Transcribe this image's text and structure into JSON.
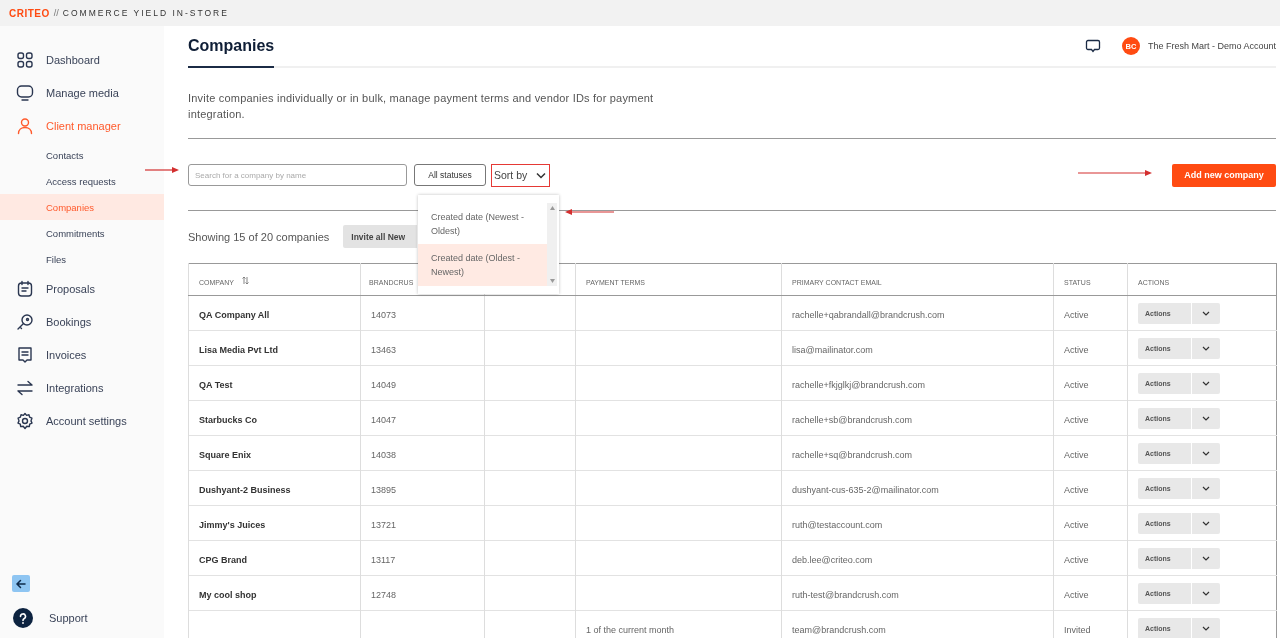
{
  "header": {
    "brand": "CRITEO",
    "separator": "//",
    "product": "COMMERCE YIELD IN-STORE"
  },
  "sidebar": {
    "items": [
      {
        "label": "Dashboard",
        "selected": false
      },
      {
        "label": "Manage media",
        "selected": false
      },
      {
        "label": "Client manager",
        "selected": true,
        "children": [
          {
            "label": "Contacts",
            "selected": false
          },
          {
            "label": "Access requests",
            "selected": false
          },
          {
            "label": "Companies",
            "selected": true
          },
          {
            "label": "Commitments",
            "selected": false
          },
          {
            "label": "Files",
            "selected": false
          }
        ]
      },
      {
        "label": "Proposals",
        "selected": false
      },
      {
        "label": "Bookings",
        "selected": false
      },
      {
        "label": "Invoices",
        "selected": false
      },
      {
        "label": "Integrations",
        "selected": false
      },
      {
        "label": "Account settings",
        "selected": false
      }
    ],
    "support": "Support"
  },
  "page": {
    "title": "Companies",
    "description": "Invite companies individually or in bulk, manage payment terms and vendor IDs for payment integration.",
    "account": {
      "initials": "BC",
      "name": "The Fresh Mart - Demo Account"
    }
  },
  "toolbar": {
    "search": {
      "placeholder": "Search for a company by name"
    },
    "status_filter": "All statuses",
    "sort": "Sort by",
    "add_button": "Add new company"
  },
  "sort_menu": {
    "options": [
      {
        "label": "Created date (Newest - Oldest)",
        "selected": false
      },
      {
        "label": "Created date (Oldest - Newest)",
        "selected": true
      }
    ]
  },
  "summary": "Showing 15 of 20 companies",
  "invite_button": "Invite all New",
  "table": {
    "columns": [
      {
        "kind": "text",
        "label": "COMPANY",
        "sortable": true
      },
      {
        "kind": "text",
        "label": "BRANDCRUS"
      },
      {
        "kind": "empty"
      },
      {
        "kind": "text",
        "label": "PAYMENT TERMS"
      },
      {
        "kind": "text",
        "label": "PRIMARY CONTACT EMAIL"
      },
      {
        "kind": "text",
        "label": "STATUS"
      },
      {
        "kind": "text",
        "label": "ACTIONS"
      }
    ],
    "rows": [
      {
        "company": "QA Company All",
        "brandcrush_id": "14073",
        "email": "rachelle+qabrandall@brandcrush.com",
        "status": "Active",
        "action": "Actions"
      },
      {
        "company": "Lisa Media Pvt Ltd",
        "brandcrush_id": "13463",
        "email": "lisa@mailinator.com",
        "status": "Active",
        "action": "Actions"
      },
      {
        "company": "QA Test",
        "brandcrush_id": "14049",
        "email": "rachelle+fkjglkj@brandcrush.com",
        "status": "Active",
        "action": "Actions"
      },
      {
        "company": "Starbucks Co",
        "brandcrush_id": "14047",
        "email": "rachelle+sb@brandcrush.com",
        "status": "Active",
        "action": "Actions"
      },
      {
        "company": "Square Enix",
        "brandcrush_id": "14038",
        "email": "rachelle+sq@brandcrush.com",
        "status": "Active",
        "action": "Actions"
      },
      {
        "company": "Dushyant-2 Business",
        "brandcrush_id": "13895",
        "email": "dushyant-cus-635-2@mailinator.com",
        "status": "Active",
        "action": "Actions"
      },
      {
        "company": "Jimmy's Juices",
        "brandcrush_id": "13721",
        "email": "ruth@testaccount.com",
        "status": "Active",
        "action": "Actions"
      },
      {
        "company": "CPG Brand",
        "brandcrush_id": "13117",
        "email": "deb.lee@criteo.com",
        "status": "Active",
        "action": "Actions"
      },
      {
        "company": "My cool shop",
        "brandcrush_id": "12748",
        "email": "ruth-test@brandcrush.com",
        "status": "Active",
        "action": "Actions"
      },
      {
        "payment_terms": "1 of the current month",
        "email": "team@brandcrush.com",
        "status": "Invited",
        "action": "Actions"
      }
    ]
  }
}
